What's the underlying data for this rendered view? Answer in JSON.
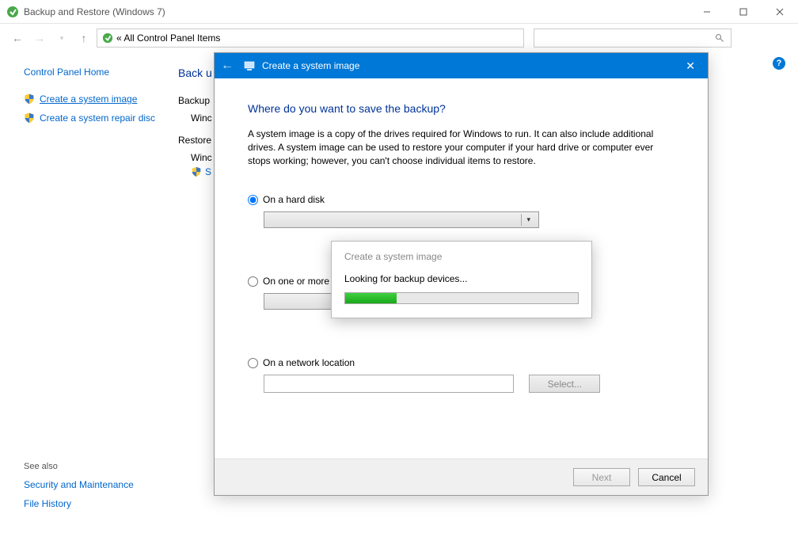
{
  "window": {
    "title": "Backup and Restore (Windows 7)"
  },
  "addressbar": {
    "text": "« All Control Panel Items"
  },
  "sidebar": {
    "home": "Control Panel Home",
    "links": [
      {
        "label": "Create a system image",
        "active": true
      },
      {
        "label": "Create a system repair disc",
        "active": false
      }
    ],
    "see_also_header": "See also",
    "see_also": [
      "Security and Maintenance",
      "File History"
    ]
  },
  "content": {
    "heading": "Back u",
    "section1": "Backup",
    "sub1": "Winc",
    "section2": "Restore",
    "sub2": "Winc",
    "sub3": "S"
  },
  "wizard": {
    "title": "Create a system image",
    "heading": "Where do you want to save the backup?",
    "description": "A system image is a copy of the drives required for Windows to run. It can also include additional drives. A system image can be used to restore your computer if your hard drive or computer ever stops working; however, you can't choose individual items to restore.",
    "option_hd": "On a hard disk",
    "option_dvd": "On one or more D",
    "option_net": "On a network location",
    "select_btn": "Select...",
    "next_btn": "Next",
    "cancel_btn": "Cancel"
  },
  "popup": {
    "title": "Create a system image",
    "message": "Looking for backup devices...",
    "progress_percent": 22
  }
}
